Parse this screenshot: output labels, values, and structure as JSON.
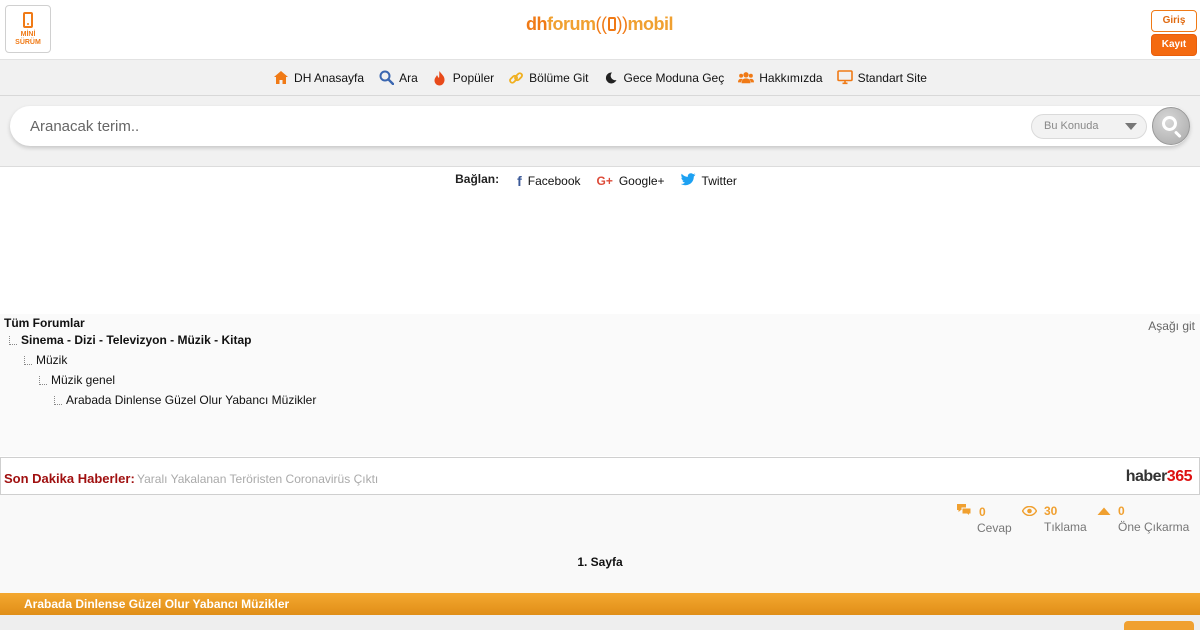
{
  "header": {
    "mini_label_line1": "MİNİ",
    "mini_label_line2": "SÜRÜM",
    "logo_dh": "dh",
    "logo_forum": "forum",
    "logo_wave_left": "((",
    "logo_wave_right": "))",
    "logo_mobil": "mobil",
    "login_label": "Giriş",
    "register_label": "Kayıt"
  },
  "nav": {
    "items": [
      {
        "label": "DH Anasayfa",
        "icon": "home-icon"
      },
      {
        "label": "Ara",
        "icon": "search-icon"
      },
      {
        "label": "Popüler",
        "icon": "fire-icon"
      },
      {
        "label": "Bölüme Git",
        "icon": "link-icon"
      },
      {
        "label": "Gece Moduna Geç",
        "icon": "moon-icon"
      },
      {
        "label": "Hakkımızda",
        "icon": "users-icon"
      },
      {
        "label": "Standart Site",
        "icon": "monitor-icon"
      }
    ]
  },
  "search": {
    "placeholder": "Aranacak terim..",
    "scope": "Bu Konuda"
  },
  "social": {
    "connect_label": "Bağlan:",
    "facebook": "Facebook",
    "google": "Google+",
    "twitter": "Twitter"
  },
  "breadcrumb": {
    "all_forums": "Tüm Forumlar",
    "go_down": "Aşağı git",
    "level1": "Sinema - Dizi - Televizyon - Müzik - Kitap",
    "level2": "Müzik",
    "level3": "Müzik genel",
    "level4": "Arabada Dinlense Güzel Olur Yabancı Müzikler"
  },
  "news": {
    "label": "Son Dakika Haberler:",
    "headline": "Yaralı Yakalanan Teröristen Coronavirüs Çıktı",
    "brand_text": "haber",
    "brand_num": "365"
  },
  "stats": {
    "replies_value": "0",
    "replies_label": "Cevap",
    "views_value": "30",
    "views_label": "Tıklama",
    "promote_value": "0",
    "promote_label": "Öne Çıkarma"
  },
  "pagination": {
    "current": "1. Sayfa"
  },
  "topic": {
    "title": "Arabada Dinlense Güzel Olur Yabancı Müzikler"
  },
  "colors": {
    "accent": "#f07a16",
    "topic_bar": "#f0a030",
    "news_label": "#a01010"
  }
}
